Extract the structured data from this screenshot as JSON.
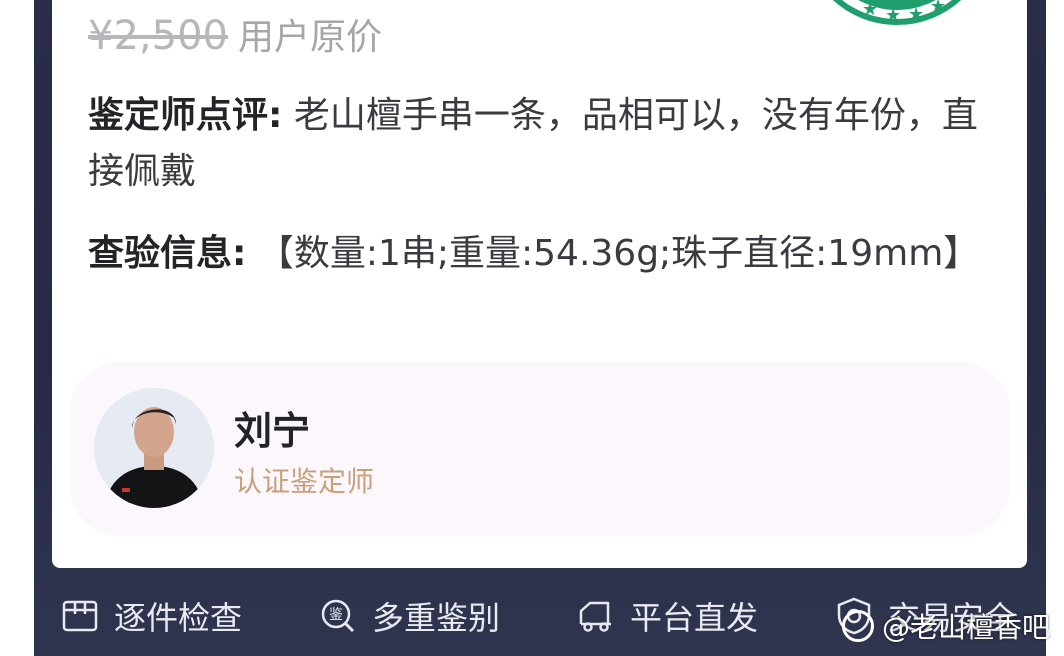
{
  "price": {
    "original": "¥2,500",
    "note": "用户原价"
  },
  "appraiser_review": {
    "label": "鉴定师点评:",
    "text": " 老山檀手串一条，品相可以，没有年份，直接佩戴"
  },
  "inspection": {
    "label": "查验信息:",
    "text": " 【数量:1串;重量:54.36g;珠子直径:19mm】"
  },
  "expert": {
    "name": "刘宁",
    "title": "认证鉴定师"
  },
  "features": [
    {
      "icon": "box-icon",
      "label": "逐件检查"
    },
    {
      "icon": "magnify-appraise-icon",
      "label": "多重鉴别"
    },
    {
      "icon": "truck-icon",
      "label": "平台直发"
    },
    {
      "icon": "shield-icon",
      "label": "交易安全"
    }
  ],
  "watermark": {
    "text": "@老山檀香吧"
  },
  "colors": {
    "background": "#2a2d49",
    "card": "#ffffff",
    "expert_panel": "#fbf7fc",
    "expert_title": "#c8a17a",
    "seal_green": "#1f9e6e"
  }
}
